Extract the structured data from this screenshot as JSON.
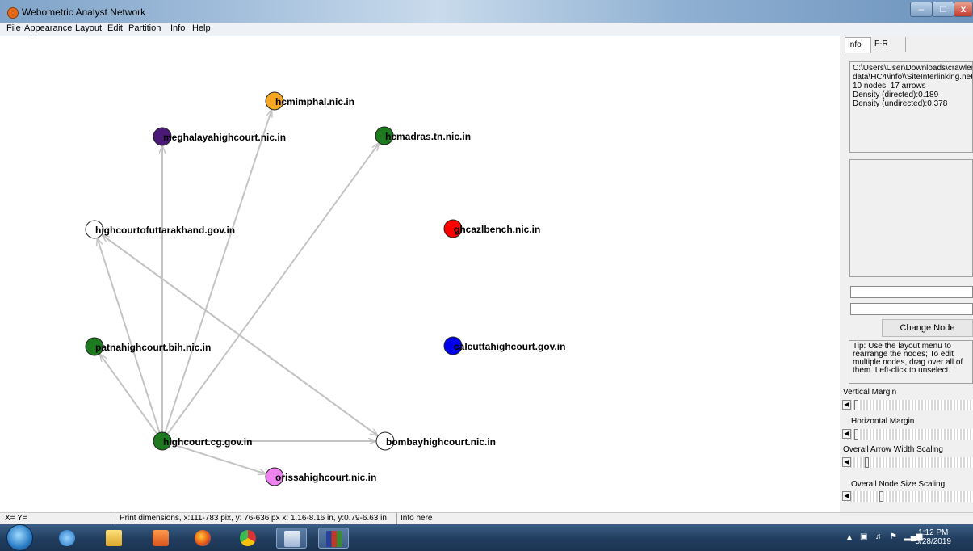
{
  "window": {
    "title": "Webometric Analyst Network",
    "min_label": "–",
    "max_label": "□",
    "close_label": "x"
  },
  "menu": [
    "File",
    "Appearance",
    "Layout",
    "Edit",
    "Partition",
    "Info",
    "Help"
  ],
  "graph": {
    "nodes": [
      {
        "id": "hcmimphal",
        "label": "hcmimphal.nic.in",
        "color": "#f5a623"
      },
      {
        "id": "meghalaya",
        "label": "meghalayahighcourt.nic.in",
        "color": "#4b1a78"
      },
      {
        "id": "hcmadras",
        "label": "hcmadras.tn.nic.in",
        "color": "#1e7a1e"
      },
      {
        "id": "uttarakhand",
        "label": "highcourtofuttarakhand.gov.in",
        "color": "#ffffff"
      },
      {
        "id": "allahabad",
        "label": "ghcazlbench.nic.in",
        "color": "#ff0000"
      },
      {
        "id": "patna",
        "label": "patnahighcourt.bih.nic.in",
        "color": "#1e7a1e"
      },
      {
        "id": "calcutta",
        "label": "calcuttahighcourt.gov.in",
        "color": "#0000ee"
      },
      {
        "id": "cg",
        "label": "highcourt.cg.gov.in",
        "color": "#1e7a1e"
      },
      {
        "id": "bombay",
        "label": "bombayhighcourt.nic.in",
        "color": "#ffffff"
      },
      {
        "id": "orissa",
        "label": "orissahighcourt.nic.in",
        "color": "#ee82ee"
      }
    ],
    "edges": [
      [
        "cg",
        "hcmimphal"
      ],
      [
        "cg",
        "meghalaya"
      ],
      [
        "cg",
        "hcmadras"
      ],
      [
        "cg",
        "uttarakhand"
      ],
      [
        "cg",
        "patna"
      ],
      [
        "cg",
        "bombay"
      ],
      [
        "cg",
        "orissa"
      ],
      [
        "bombay",
        "uttarakhand"
      ],
      [
        "uttarakhand",
        "bombay"
      ]
    ],
    "edge_color": "#c4c4c4"
  },
  "sidebar": {
    "tabs": [
      "Info",
      "F-R"
    ],
    "info_lines": [
      "C:\\Users\\User\\Downloads\\crawler",
      "data\\HC4\\info\\\\SiteInterlinking.net",
      "10 nodes, 17 arrows",
      "Density (directed):0.189",
      "Density (undirected):0.378"
    ],
    "change_button": "Change Node Properties",
    "tip": "Tip: Use the layout menu to rearrange the nodes; To edit multiple nodes, drag over all of them. Left-click to unselect.",
    "sliders": [
      {
        "label": "Vertical Margin",
        "value": 0.03
      },
      {
        "label": "Horizontal Margin",
        "value": 0.03
      },
      {
        "label": "Overall Arrow Width Scaling",
        "value": 0.12
      },
      {
        "label": "Overall Node Size Scaling",
        "value": 0.25
      }
    ]
  },
  "status": {
    "coords": "X= Y=",
    "print_dims": "Print dimensions, x:111-783 pix, y: 76-636 px x: 1.16-8.16 in, y:0.79-6.63 in",
    "info": "Info here"
  },
  "taskbar": {
    "time": "1:12 PM",
    "date": "5/28/2019",
    "apps": [
      "ie-icon",
      "explorer-icon",
      "media-icon",
      "firefox-icon",
      "chrome-icon",
      "word-icon",
      "books-icon"
    ]
  }
}
